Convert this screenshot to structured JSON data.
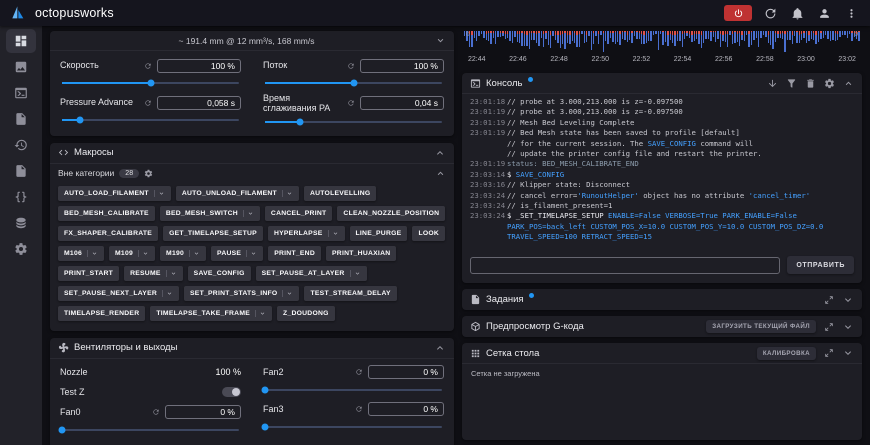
{
  "theme": {
    "accent": "#2196f3",
    "danger": "#bf3232"
  },
  "topbar": {
    "title": "octopusworks",
    "actions": [
      {
        "name": "emergency-stop-button",
        "icon": "power",
        "style": "danger"
      },
      {
        "name": "update-button",
        "icon": "update"
      },
      {
        "name": "notifications-button",
        "icon": "bell"
      },
      {
        "name": "account-button",
        "icon": "account"
      },
      {
        "name": "menu-button",
        "icon": "dots-vertical"
      }
    ]
  },
  "sidebar": {
    "items": [
      {
        "name": "dashboard",
        "icon": "view-dashboard",
        "active": true
      },
      {
        "name": "webcam",
        "icon": "image",
        "active": false
      },
      {
        "name": "console",
        "icon": "console",
        "active": false
      },
      {
        "name": "gcode-files",
        "icon": "file-document",
        "active": false
      },
      {
        "name": "history",
        "icon": "history",
        "active": false
      },
      {
        "name": "machine",
        "icon": "file-document",
        "active": false
      },
      {
        "name": "configuration",
        "icon": "braces",
        "active": false
      },
      {
        "name": "logs",
        "icon": "database",
        "active": false
      },
      {
        "name": "settings",
        "icon": "cog",
        "active": false
      }
    ]
  },
  "left": {
    "speed_card": {
      "header": "~ 191.4 mm @ 12 mm³/s, 168 mm/s",
      "sliders": [
        {
          "label": "Скорость",
          "value": "100 %",
          "pos": 50
        },
        {
          "label": "Поток",
          "value": "100 %",
          "pos": 50
        },
        {
          "label": "Pressure Advance",
          "value": "0,058 s",
          "pos": 10
        },
        {
          "label": "Время сглаживания PA",
          "value": "0,04 s",
          "pos": 20
        }
      ]
    },
    "macros_card": {
      "title": "Макросы",
      "category_label": "Вне категории",
      "category_count": "28",
      "macros": [
        {
          "label": "AUTO_LOAD_FILAMENT",
          "dropdown": true
        },
        {
          "label": "AUTO_UNLOAD_FILAMENT",
          "dropdown": true
        },
        {
          "label": "AUTOLEVELLING",
          "dropdown": false
        },
        {
          "label": "BED_MESH_CALIBRATE",
          "dropdown": false
        },
        {
          "label": "BED_MESH_SWITCH",
          "dropdown": true
        },
        {
          "label": "CANCEL_PRINT",
          "dropdown": false
        },
        {
          "label": "CLEAN_NOZZLE_POSITION",
          "dropdown": false
        },
        {
          "label": "FX_SHAPER_CALIBRATE",
          "dropdown": false
        },
        {
          "label": "GET_TIMELAPSE_SETUP",
          "dropdown": false
        },
        {
          "label": "HYPERLAPSE",
          "dropdown": true
        },
        {
          "label": "LINE_PURGE",
          "dropdown": false
        },
        {
          "label": "LOOK",
          "dropdown": false
        },
        {
          "label": "M106",
          "dropdown": true
        },
        {
          "label": "M109",
          "dropdown": true
        },
        {
          "label": "M190",
          "dropdown": true
        },
        {
          "label": "PAUSE",
          "dropdown": true
        },
        {
          "label": "PRINT_END",
          "dropdown": false
        },
        {
          "label": "PRINT_HUAXIAN",
          "dropdown": false
        },
        {
          "label": "PRINT_START",
          "dropdown": false
        },
        {
          "label": "RESUME",
          "dropdown": true
        },
        {
          "label": "SAVE_CONFIG",
          "dropdown": false
        },
        {
          "label": "SET_PAUSE_AT_LAYER",
          "dropdown": true
        },
        {
          "label": "SET_PAUSE_NEXT_LAYER",
          "dropdown": true
        },
        {
          "label": "SET_PRINT_STATS_INFO",
          "dropdown": true
        },
        {
          "label": "TEST_STREAM_DELAY",
          "dropdown": false
        },
        {
          "label": "TIMELAPSE_RENDER",
          "dropdown": false
        },
        {
          "label": "TIMELAPSE_TAKE_FRAME",
          "dropdown": true
        },
        {
          "label": "Z_DOUDONG",
          "dropdown": false
        }
      ]
    },
    "fans_card": {
      "title": "Вентиляторы и выходы",
      "left_items": [
        {
          "label": "Nozzle",
          "value": "100 %",
          "type": "value"
        },
        {
          "label": "Test Z",
          "type": "toggle",
          "on": true
        },
        {
          "label": "Fan0",
          "value": "0 %",
          "type": "slider",
          "pos": 0
        }
      ],
      "right_items": [
        {
          "label": "Fan2",
          "value": "0 %",
          "type": "slider",
          "pos": 0
        },
        {
          "label": "Fan3",
          "value": "0 %",
          "type": "slider",
          "pos": 0
        }
      ]
    }
  },
  "right": {
    "graph": {
      "y_left": "0",
      "y_right": "0",
      "times": [
        "22:44",
        "22:46",
        "22:48",
        "22:50",
        "22:52",
        "22:54",
        "22:56",
        "22:58",
        "23:00",
        "23:02"
      ]
    },
    "console_card": {
      "title": "Консоль",
      "header_icons": [
        "arrow-down",
        "filter",
        "trash",
        "cog",
        "chevron-up"
      ],
      "send_label": "ОТПРАВИТЬ",
      "lines": [
        {
          "time": "23:01:18",
          "parts": [
            {
              "t": "// probe at 3.000,213.000 is z=-0.097500",
              "c": "comment"
            }
          ]
        },
        {
          "time": "23:01:19",
          "parts": [
            {
              "t": "// probe at 3.000,213.000 is z=-0.097500",
              "c": "comment"
            }
          ]
        },
        {
          "time": "23:01:19",
          "parts": [
            {
              "t": "// Mesh Bed Leveling Complete",
              "c": "comment"
            }
          ]
        },
        {
          "time": "23:01:19",
          "parts": [
            {
              "t": "// Bed Mesh state has been saved to profile [default]",
              "c": "comment"
            }
          ]
        },
        {
          "time": "",
          "parts": [
            {
              "t": "// for the current session. The ",
              "c": "comment"
            },
            {
              "t": "SAVE_CONFIG",
              "c": "accent"
            },
            {
              "t": " command will",
              "c": "comment"
            }
          ]
        },
        {
          "time": "",
          "parts": [
            {
              "t": "// update the printer config file and restart the printer.",
              "c": "comment"
            }
          ]
        },
        {
          "time": "23:01:19",
          "parts": [
            {
              "t": "status: BED_MESH_CALIBRATE_END",
              "c": "status"
            }
          ]
        },
        {
          "time": "23:03:14",
          "parts": [
            {
              "t": "$ ",
              "c": "command"
            },
            {
              "t": "SAVE_CONFIG",
              "c": "accent"
            }
          ]
        },
        {
          "time": "23:03:16",
          "parts": [
            {
              "t": "// Klipper state: Disconnect",
              "c": "comment"
            }
          ]
        },
        {
          "time": "23:03:24",
          "parts": [
            {
              "t": "// cancel error=",
              "c": "comment"
            },
            {
              "t": "'RunoutHelper'",
              "c": "accent"
            },
            {
              "t": " object has no attribute ",
              "c": "comment"
            },
            {
              "t": "'cancel_timer'",
              "c": "accent"
            }
          ]
        },
        {
          "time": "23:03:24",
          "parts": [
            {
              "t": "// is_filament_present=1",
              "c": "comment"
            }
          ]
        },
        {
          "time": "23:03:24",
          "parts": [
            {
              "t": "$ _SET_TIMELAPSE_SETUP ",
              "c": "command"
            },
            {
              "t": "ENABLE=False VERBOSE=True PARK_ENABLE=False PARK_POS=back_left CUSTOM_POS_X=10.0 CUSTOM_POS_Y=10.0 CUSTOM_POS_DZ=0.0 TRAVEL_SPEED=100 RETRACT_SPEED=15",
              "c": "accent"
            }
          ]
        }
      ]
    },
    "jobs_card": {
      "title": "Задания"
    },
    "gcode_card": {
      "title": "Предпросмотр G-кода",
      "load_label": "ЗАГРУЗИТЬ ТЕКУЩИЙ ФАЙЛ"
    },
    "mesh_card": {
      "title": "Сетка стола",
      "calibrate_label": "КАЛИБРОВКА",
      "empty_text": "Сетка не загружена"
    }
  }
}
